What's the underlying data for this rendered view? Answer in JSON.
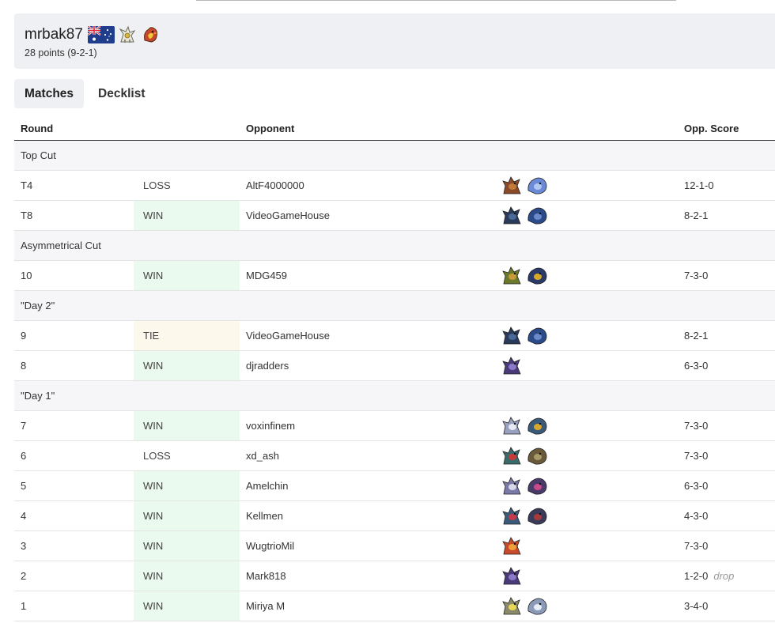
{
  "player": {
    "name": "mrbak87",
    "flag_icon": "australia-flag-icon",
    "points_text": "28 points (9-2-1)",
    "deck_icons": [
      "arceus-sprite-icon",
      "fire-bird-sprite-icon"
    ]
  },
  "tabs": [
    {
      "label": "Matches",
      "active": true
    },
    {
      "label": "Decklist",
      "active": false
    }
  ],
  "table": {
    "headers": [
      "Round",
      "",
      "Opponent",
      "",
      "Opp. Score"
    ],
    "rows": [
      {
        "type": "section",
        "label": "Top Cut"
      },
      {
        "type": "match",
        "round": "T4",
        "result": "LOSS",
        "opponent": "AltF4000000",
        "score": "12-1-0",
        "drop": "",
        "icons": [
          {
            "c1": "#8a4a2a",
            "c2": "#c47a3a"
          },
          {
            "c1": "#6a8ad8",
            "c2": "#b0c8f0"
          }
        ]
      },
      {
        "type": "match",
        "round": "T8",
        "result": "WIN",
        "opponent": "VideoGameHouse",
        "score": "8-2-1",
        "drop": "",
        "icons": [
          {
            "c1": "#2a3a5a",
            "c2": "#4a6a9a"
          },
          {
            "c1": "#2a4a8a",
            "c2": "#6a8acc"
          }
        ]
      },
      {
        "type": "section",
        "label": "Asymmetrical Cut"
      },
      {
        "type": "match",
        "round": "10",
        "result": "WIN",
        "opponent": "MDG459",
        "score": "7-3-0",
        "drop": "",
        "icons": [
          {
            "c1": "#6a7a2a",
            "c2": "#c89a3a"
          },
          {
            "c1": "#2a3a6a",
            "c2": "#d8a82a"
          }
        ]
      },
      {
        "type": "section",
        "label": "\"Day 2\""
      },
      {
        "type": "match",
        "round": "9",
        "result": "TIE",
        "opponent": "VideoGameHouse",
        "score": "8-2-1",
        "drop": "",
        "icons": [
          {
            "c1": "#2a3a5a",
            "c2": "#4a6a9a"
          },
          {
            "c1": "#2a4a8a",
            "c2": "#6a8acc"
          }
        ]
      },
      {
        "type": "match",
        "round": "8",
        "result": "WIN",
        "opponent": "djradders",
        "score": "6-3-0",
        "drop": "",
        "icons": [
          {
            "c1": "#4a3a7a",
            "c2": "#8a7ac8"
          }
        ]
      },
      {
        "type": "section",
        "label": "\"Day 1\""
      },
      {
        "type": "match",
        "round": "7",
        "result": "WIN",
        "opponent": "voxinfinem",
        "score": "7-3-0",
        "drop": "",
        "icons": [
          {
            "c1": "#9aa0c0",
            "c2": "#e8eaf4"
          },
          {
            "c1": "#3a5a7a",
            "c2": "#d8a82a"
          }
        ]
      },
      {
        "type": "match",
        "round": "6",
        "result": "LOSS",
        "opponent": "xd_ash",
        "score": "7-3-0",
        "drop": "",
        "icons": [
          {
            "c1": "#3a6a6a",
            "c2": "#c83a3a"
          },
          {
            "c1": "#6a5a3a",
            "c2": "#a89a6a"
          }
        ]
      },
      {
        "type": "match",
        "round": "5",
        "result": "WIN",
        "opponent": "Amelchin",
        "score": "6-3-0",
        "drop": "",
        "icons": [
          {
            "c1": "#7a7aa8",
            "c2": "#d8d8e8"
          },
          {
            "c1": "#4a3a6a",
            "c2": "#c84a8a"
          }
        ]
      },
      {
        "type": "match",
        "round": "4",
        "result": "WIN",
        "opponent": "Kellmen",
        "score": "4-3-0",
        "drop": "",
        "icons": [
          {
            "c1": "#3a5a7a",
            "c2": "#c83a4a"
          },
          {
            "c1": "#3a3a5a",
            "c2": "#a83a3a"
          }
        ]
      },
      {
        "type": "match",
        "round": "3",
        "result": "WIN",
        "opponent": "WugtrioMil",
        "score": "7-3-0",
        "drop": "",
        "icons": [
          {
            "c1": "#c84a2a",
            "c2": "#f0a03a"
          }
        ]
      },
      {
        "type": "match",
        "round": "2",
        "result": "WIN",
        "opponent": "Mark818",
        "score": "1-2-0",
        "drop": "drop",
        "icons": [
          {
            "c1": "#4a3a7a",
            "c2": "#8a7ac8"
          }
        ]
      },
      {
        "type": "match",
        "round": "1",
        "result": "WIN",
        "opponent": "Miriya M",
        "score": "3-4-0",
        "drop": "",
        "icons": [
          {
            "c1": "#8a8a6a",
            "c2": "#e8d85a"
          },
          {
            "c1": "#8a9ab8",
            "c2": "#e8eef8"
          }
        ]
      }
    ]
  }
}
